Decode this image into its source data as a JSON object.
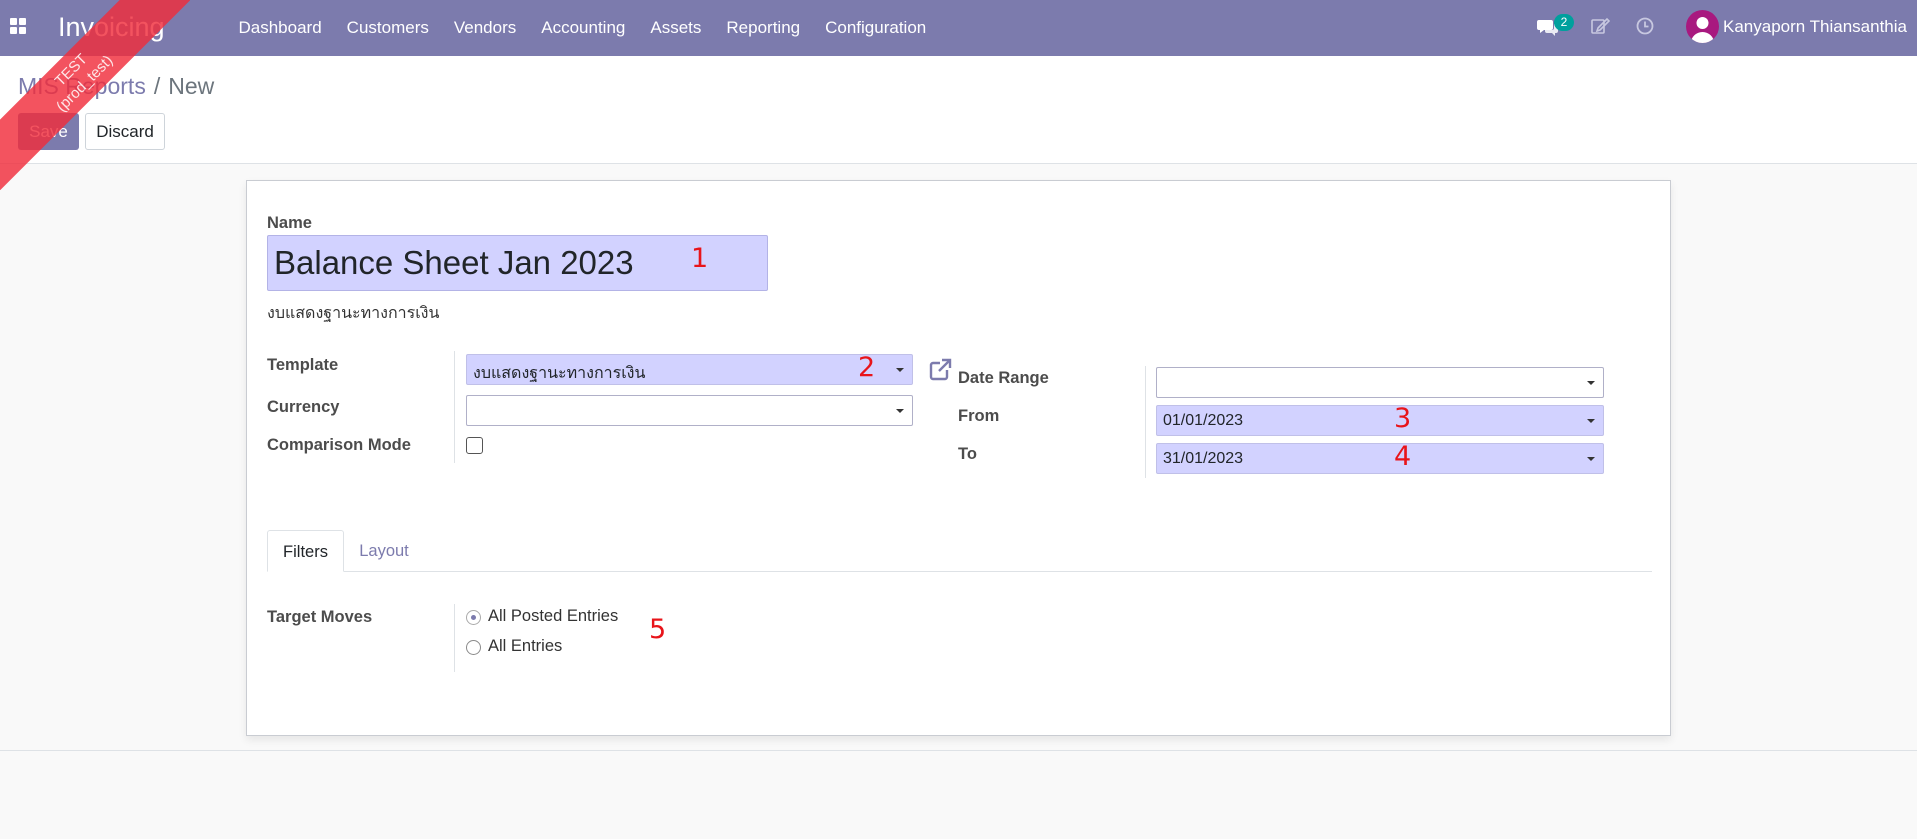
{
  "navbar": {
    "brand": "Invoicing",
    "menu": [
      "Dashboard",
      "Customers",
      "Vendors",
      "Accounting",
      "Assets",
      "Reporting",
      "Configuration"
    ],
    "chat_count": "2",
    "user_name": "Kanyaporn Thiansanthia",
    "color": "#7c7bad"
  },
  "ribbon": {
    "line1": "TEST",
    "line2": "(prod_test)"
  },
  "breadcrumb": {
    "parent": "MIS Reports",
    "separator": "/",
    "current": "New"
  },
  "buttons": {
    "save": "Save",
    "discard": "Discard"
  },
  "form": {
    "name_label": "Name",
    "name_value": "Balance Sheet Jan 2023",
    "subtitle": "งบแสดงฐานะทางการเงิน",
    "template_label": "Template",
    "template_value": "งบแสดงฐานะทางการเงิน",
    "currency_label": "Currency",
    "currency_value": "",
    "comparison_label": "Comparison Mode",
    "comparison_checked": false,
    "date_range_label": "Date Range",
    "date_range_value": "",
    "from_label": "From",
    "from_value": "01/01/2023",
    "to_label": "To",
    "to_value": "31/01/2023"
  },
  "tabs": [
    "Filters",
    "Layout"
  ],
  "filters": {
    "target_moves_label": "Target Moves",
    "options": [
      "All Posted Entries",
      "All Entries"
    ],
    "selected": "All Posted Entries"
  },
  "annotations": [
    "1",
    "2",
    "3",
    "4",
    "5"
  ]
}
